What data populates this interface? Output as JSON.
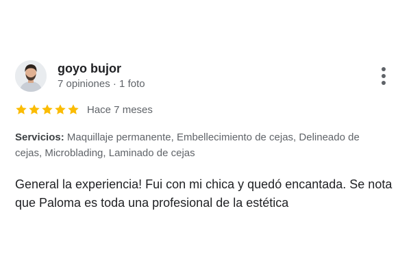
{
  "review": {
    "author": {
      "name": "goyo bujor",
      "meta": "7 opiniones · 1 foto"
    },
    "rating": 5,
    "time": "Hace 7 meses",
    "services": {
      "label": "Servicios:",
      "list": " Maquillaje permanente, Embellecimiento de cejas, Delineado de cejas, Microblading, Laminado de cejas"
    },
    "text": "General la experiencia! Fui con mi chica y quedó encantada. Se nota que Paloma es toda una profesional de la estética",
    "icons": {
      "avatar": "user-avatar-photo",
      "more": "more-vertical-icon",
      "star": "star-icon"
    },
    "colors": {
      "star": "#fbbc04",
      "text_primary": "#202124",
      "text_secondary": "#5f6368"
    }
  }
}
